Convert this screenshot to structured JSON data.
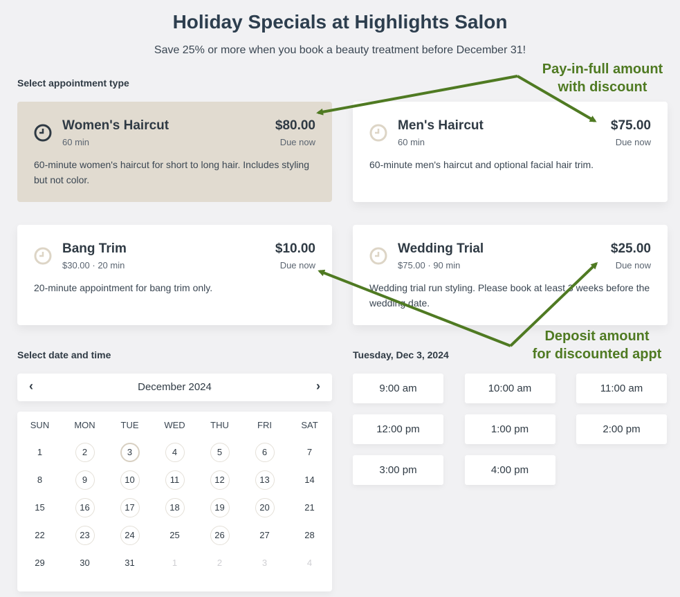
{
  "header": {
    "title": "Holiday Specials at Highlights Salon",
    "subtitle": "Save 25% or more when you book a beauty treatment before December 31!"
  },
  "appointment_section": {
    "label": "Select appointment type",
    "cards": [
      {
        "name": "Women's Haircut",
        "meta": "60 min",
        "price": "$80.00",
        "due": "Due now",
        "description": "60-minute women's haircut for short to long hair. Includes styling but not color.",
        "selected": true
      },
      {
        "name": "Men's Haircut",
        "meta": "60 min",
        "price": "$75.00",
        "due": "Due now",
        "description": "60-minute men's haircut and optional facial hair trim.",
        "selected": false
      },
      {
        "name": "Bang Trim",
        "meta": "$30.00 · 20 min",
        "price": "$10.00",
        "due": "Due now",
        "description": "20-minute appointment for bang trim only.",
        "selected": false
      },
      {
        "name": "Wedding Trial",
        "meta": "$75.00 · 90 min",
        "price": "$25.00",
        "due": "Due now",
        "description": "Wedding trial run styling. Please book at least 3 weeks before the wedding date.",
        "selected": false
      }
    ]
  },
  "calendar": {
    "label": "Select date and time",
    "month": "December 2024",
    "prev_icon": "chevron-left-icon",
    "next_icon": "chevron-right-icon",
    "weekdays": [
      "SUN",
      "MON",
      "TUE",
      "WED",
      "THU",
      "FRI",
      "SAT"
    ],
    "weeks": [
      [
        {
          "d": "1",
          "s": "plain"
        },
        {
          "d": "2",
          "s": "avail"
        },
        {
          "d": "3",
          "s": "selected"
        },
        {
          "d": "4",
          "s": "avail"
        },
        {
          "d": "5",
          "s": "avail"
        },
        {
          "d": "6",
          "s": "avail"
        },
        {
          "d": "7",
          "s": "plain"
        }
      ],
      [
        {
          "d": "8",
          "s": "plain"
        },
        {
          "d": "9",
          "s": "avail"
        },
        {
          "d": "10",
          "s": "avail"
        },
        {
          "d": "11",
          "s": "avail"
        },
        {
          "d": "12",
          "s": "avail"
        },
        {
          "d": "13",
          "s": "avail"
        },
        {
          "d": "14",
          "s": "plain"
        }
      ],
      [
        {
          "d": "15",
          "s": "plain"
        },
        {
          "d": "16",
          "s": "avail"
        },
        {
          "d": "17",
          "s": "avail"
        },
        {
          "d": "18",
          "s": "avail"
        },
        {
          "d": "19",
          "s": "avail"
        },
        {
          "d": "20",
          "s": "avail"
        },
        {
          "d": "21",
          "s": "plain"
        }
      ],
      [
        {
          "d": "22",
          "s": "plain"
        },
        {
          "d": "23",
          "s": "avail"
        },
        {
          "d": "24",
          "s": "avail"
        },
        {
          "d": "25",
          "s": "plain"
        },
        {
          "d": "26",
          "s": "avail"
        },
        {
          "d": "27",
          "s": "plain"
        },
        {
          "d": "28",
          "s": "plain"
        }
      ],
      [
        {
          "d": "29",
          "s": "plain"
        },
        {
          "d": "30",
          "s": "plain"
        },
        {
          "d": "31",
          "s": "plain"
        },
        {
          "d": "1",
          "s": "muted"
        },
        {
          "d": "2",
          "s": "muted"
        },
        {
          "d": "3",
          "s": "muted"
        },
        {
          "d": "4",
          "s": "muted"
        }
      ]
    ]
  },
  "times": {
    "heading": "Tuesday, Dec 3, 2024",
    "slots": [
      "9:00 am",
      "10:00 am",
      "11:00 am",
      "12:00 pm",
      "1:00 pm",
      "2:00 pm",
      "3:00 pm",
      "4:00 pm"
    ]
  },
  "annotations": {
    "top_line1": "Pay-in-full amount",
    "top_line2": "with discount",
    "bottom_line1": "Deposit amount",
    "bottom_line2": "for discounted appt",
    "color": "#4f7a22"
  },
  "colors": {
    "selected_card": "#e1dbd0",
    "page_bg": "#f1f1f3",
    "clock_selected": "#2f3a44",
    "clock_default": "#ddd5c6"
  }
}
